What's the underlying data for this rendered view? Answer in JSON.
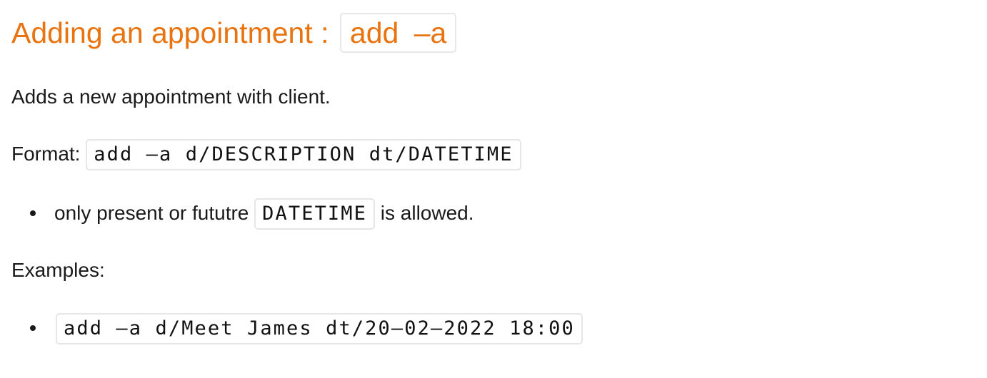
{
  "heading": {
    "text": "Adding an appointment :",
    "code": "add  –a"
  },
  "description": "Adds a new appointment with client.",
  "format": {
    "label": "Format:",
    "code": "add –a d/DESCRIPTION dt/DATETIME"
  },
  "notes": [
    {
      "before": "only present or fututre",
      "code": "DATETIME",
      "after": "is allowed."
    }
  ],
  "examples": {
    "label": "Examples:",
    "items": [
      {
        "code": "add –a d/Meet James dt/20–02–2022 18:00"
      }
    ]
  },
  "colors": {
    "heading": "#e8730f"
  }
}
